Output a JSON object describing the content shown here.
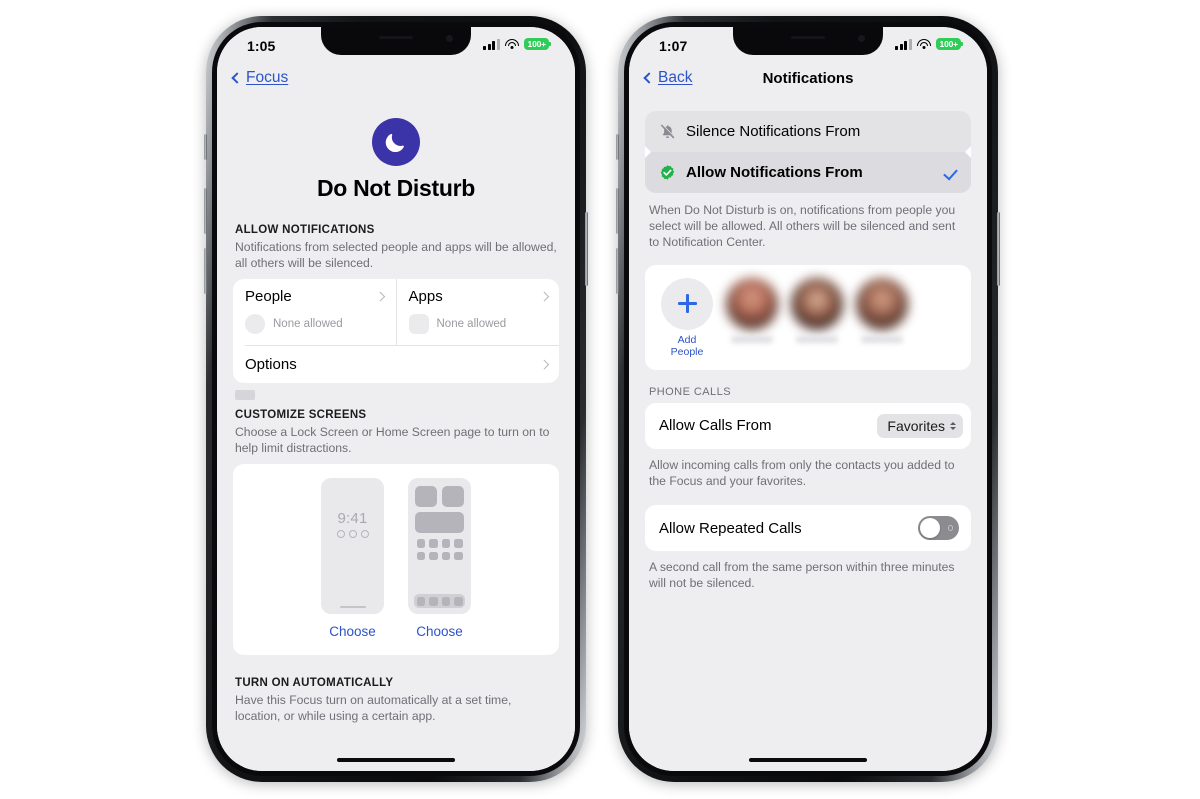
{
  "left_phone": {
    "status_bar": {
      "time": "1:05",
      "battery_label": "100+",
      "battery_color": "#2fcd58",
      "signal_icon": "cellular-bars-icon",
      "wifi_icon": "wifi-icon"
    },
    "nav": {
      "back_label": "Focus",
      "back_icon": "chevron-left-icon"
    },
    "header": {
      "icon": "crescent-moon-icon",
      "icon_bg": "#3b33a8",
      "title": "Do Not Disturb"
    },
    "allow_notifications": {
      "section_header": "ALLOW NOTIFICATIONS",
      "section_footer": "Notifications from selected people and apps will be allowed, all others will be silenced.",
      "people": {
        "label": "People",
        "value": "None allowed",
        "chevron": "chevron-right-icon",
        "placeholder": "circle-avatar-placeholder"
      },
      "apps": {
        "label": "Apps",
        "value": "None allowed",
        "chevron": "chevron-right-icon",
        "placeholder": "rounded-square-app-placeholder"
      },
      "options": {
        "label": "Options",
        "chevron": "chevron-right-icon"
      }
    },
    "customize_screens": {
      "section_header": "CUSTOMIZE SCREENS",
      "section_footer": "Choose a Lock Screen or Home Screen page to turn on to help limit distractions.",
      "lock_screen": {
        "time": "9:41",
        "choose_label": "Choose"
      },
      "home_screen": {
        "choose_label": "Choose"
      }
    },
    "turn_on_automatically": {
      "section_header": "TURN ON AUTOMATICALLY",
      "section_footer": "Have this Focus turn on automatically at a set time, location, or while using a certain app."
    }
  },
  "right_phone": {
    "status_bar": {
      "time": "1:07",
      "battery_label": "100+",
      "battery_color": "#2fcd58",
      "signal_icon": "cellular-bars-icon",
      "wifi_icon": "wifi-icon"
    },
    "nav": {
      "back_label": "Back",
      "back_icon": "chevron-left-icon",
      "title": "Notifications"
    },
    "mode_options": [
      {
        "label": "Silence Notifications From",
        "icon": "bell-slash-icon",
        "selected": false
      },
      {
        "label": "Allow Notifications From",
        "icon": "green-checkmark-seal-icon",
        "selected": true,
        "check": "checkmark-icon"
      }
    ],
    "mode_footer": "When Do Not Disturb is on, notifications from people you select will be allowed. All others will be silenced and sent to Notification Center.",
    "people": {
      "add_line1": "Add",
      "add_line2": "People",
      "add_icon": "plus-icon",
      "contacts": [
        {
          "name": ""
        },
        {
          "name": ""
        },
        {
          "name": ""
        }
      ]
    },
    "phone_calls": {
      "group_header": "PHONE CALLS",
      "allow_calls": {
        "label": "Allow Calls From",
        "value": "Favorites",
        "icon": "up-down-chevron-icon"
      },
      "allow_calls_footer": "Allow incoming calls from only the contacts you added to the Focus and your favorites.",
      "repeated": {
        "label": "Allow Repeated Calls",
        "state": "off",
        "control": "toggle-switch"
      },
      "repeated_footer": "A second call from the same person within three minutes will not be silenced."
    }
  }
}
